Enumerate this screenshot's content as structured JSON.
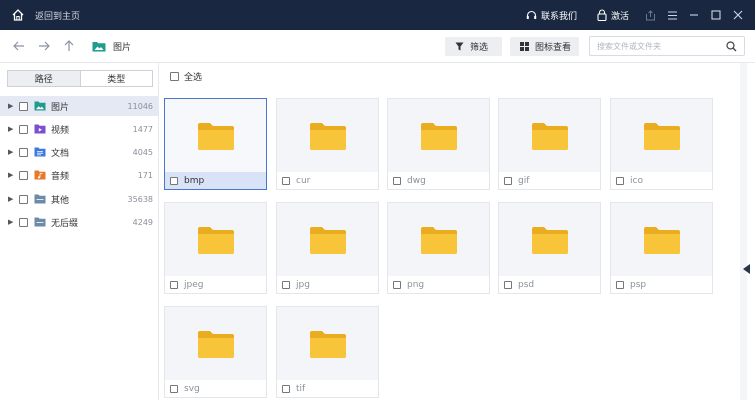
{
  "titlebar": {
    "back_home_label": "返回到主页",
    "contact_label": "联系我们",
    "activate_label": "激活"
  },
  "toolbar": {
    "current_folder": "图片",
    "filter_label": "筛选",
    "icon_view_label": "图标查看",
    "search_placeholder": "搜索文件或文件夹"
  },
  "sidebar": {
    "tabs": [
      "路径",
      "类型"
    ],
    "active_tab": "类型",
    "items": [
      {
        "label": "图片",
        "count": "11046",
        "icon": "image-folder-icon",
        "color": "#1f9c8c"
      },
      {
        "label": "视频",
        "count": "1477",
        "icon": "video-folder-icon",
        "color": "#7b4fcf"
      },
      {
        "label": "文档",
        "count": "4045",
        "icon": "document-folder-icon",
        "color": "#3b7be0"
      },
      {
        "label": "音频",
        "count": "171",
        "icon": "audio-folder-icon",
        "color": "#e8792a"
      },
      {
        "label": "其他",
        "count": "35638",
        "icon": "other-folder-icon",
        "color": "#6d8aa8"
      },
      {
        "label": "无后缀",
        "count": "4249",
        "icon": "no-extension-folder-icon",
        "color": "#6d8aa8"
      }
    ]
  },
  "main": {
    "select_all_label": "全选",
    "folders": [
      "bmp",
      "cur",
      "dwg",
      "gif",
      "ico",
      "jpeg",
      "jpg",
      "png",
      "psd",
      "psp",
      "svg",
      "tif"
    ],
    "selected_folder": "bmp"
  },
  "colors": {
    "titlebar_bg": "#1a2740",
    "folder_yellow": "#f8c53a",
    "selection_border": "#4a78c8"
  }
}
